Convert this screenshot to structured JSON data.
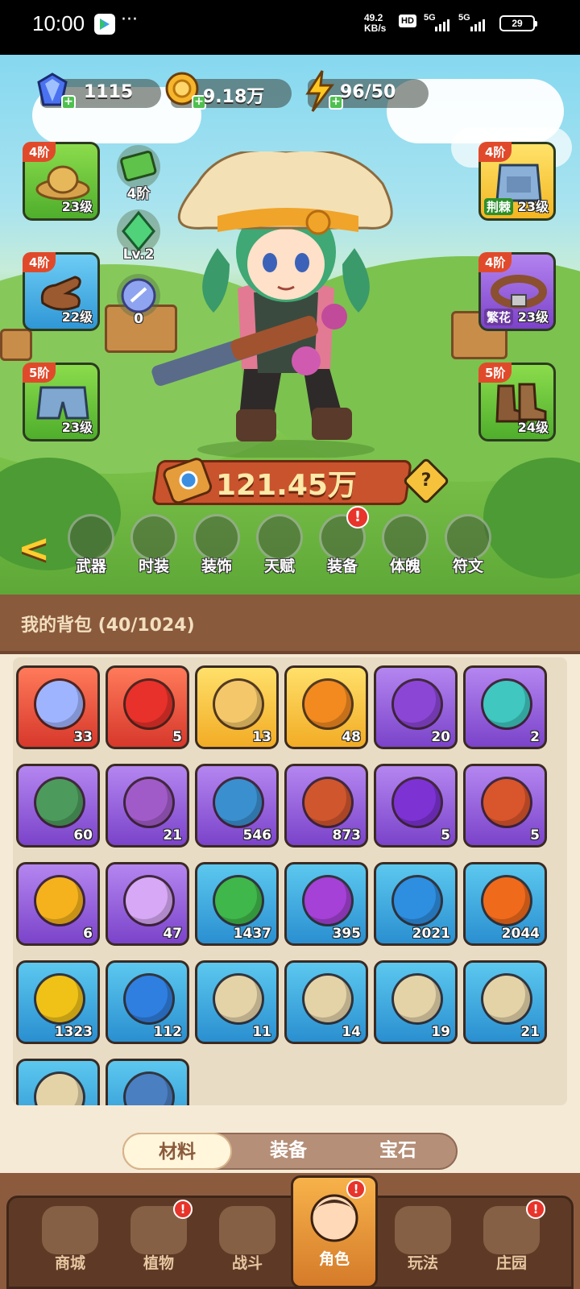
{
  "statusbar": {
    "time": "10:00",
    "more": "···",
    "speed_value": "49.2",
    "speed_unit": "KB/s",
    "hd": "HD",
    "sig1": "5G",
    "sig2": "5G",
    "battery": "29"
  },
  "resources": {
    "diamond": "1115",
    "gold": "9.18万",
    "energy": "96/50"
  },
  "equip_left": [
    {
      "tier": "4阶",
      "level": "23级",
      "icon": "straw-hat-icon"
    },
    {
      "tier": "4阶",
      "level": "22级",
      "icon": "glove-icon"
    },
    {
      "tier": "5阶",
      "level": "23级",
      "icon": "shorts-icon"
    }
  ],
  "equip_right": [
    {
      "tier": "4阶",
      "tag": "荆棘",
      "level": "23级",
      "icon": "overalls-icon"
    },
    {
      "tier": "4阶",
      "tag": "繁花",
      "level": "23级",
      "icon": "belt-icon"
    },
    {
      "tier": "5阶",
      "level": "24级",
      "icon": "boots-icon"
    }
  ],
  "mid_items": [
    {
      "label": "4阶",
      "icon": "cash-icon"
    },
    {
      "label": "Lv.2",
      "icon": "green-gem-icon"
    },
    {
      "label": "0",
      "icon": "rune-orb-icon"
    }
  ],
  "power": "121.45万",
  "help": "?",
  "nav_tabs": [
    {
      "label": "武器"
    },
    {
      "label": "时装"
    },
    {
      "label": "装饰"
    },
    {
      "label": "天赋"
    },
    {
      "label": "装备",
      "badge": "!"
    },
    {
      "label": "体魄"
    },
    {
      "label": "符文"
    }
  ],
  "bag": {
    "title": "我的背包 (40/1024)",
    "items": [
      {
        "count": "33",
        "rarity": "red",
        "icon": "star-crystal-icon",
        "color": "#9fb4ff"
      },
      {
        "count": "5",
        "rarity": "red",
        "icon": "red-potion-icon",
        "color": "#e8312a"
      },
      {
        "count": "13",
        "rarity": "gold",
        "icon": "key-icon",
        "color": "#f4c86a"
      },
      {
        "count": "48",
        "rarity": "gold",
        "icon": "orange-potion-icon",
        "color": "#f28a20"
      },
      {
        "count": "20",
        "rarity": "purple",
        "icon": "purple-bottle-icon",
        "color": "#8c46d6"
      },
      {
        "count": "2",
        "rarity": "purple",
        "icon": "leaf-icon",
        "color": "#3fc7c0"
      },
      {
        "count": "60",
        "rarity": "purple",
        "icon": "scroll-green-icon",
        "color": "#4c9a5c"
      },
      {
        "count": "21",
        "rarity": "purple",
        "icon": "scroll-purple-icon",
        "color": "#a15bc8"
      },
      {
        "count": "546",
        "rarity": "purple",
        "icon": "scroll-blue-icon",
        "color": "#3a8fcf"
      },
      {
        "count": "873",
        "rarity": "purple",
        "icon": "scroll-red-icon",
        "color": "#d0562e"
      },
      {
        "count": "5",
        "rarity": "purple",
        "icon": "purple-potion-icon",
        "color": "#7d32d4"
      },
      {
        "count": "5",
        "rarity": "purple",
        "icon": "fruit-bowl-icon",
        "color": "#d9552c"
      },
      {
        "count": "6",
        "rarity": "purple",
        "icon": "drop-icon",
        "color": "#f5b21c"
      },
      {
        "count": "47",
        "rarity": "purple",
        "icon": "crystal-icon",
        "color": "#d7a8f5"
      },
      {
        "count": "1437",
        "rarity": "blue",
        "icon": "green-seed-icon",
        "color": "#3fb74a"
      },
      {
        "count": "395",
        "rarity": "blue",
        "icon": "purple-seed-icon",
        "color": "#a541d6"
      },
      {
        "count": "2021",
        "rarity": "blue",
        "icon": "blue-seed-icon",
        "color": "#2e8ee0"
      },
      {
        "count": "2044",
        "rarity": "blue",
        "icon": "fire-seed-icon",
        "color": "#f06a1c"
      },
      {
        "count": "1323",
        "rarity": "blue",
        "icon": "yellow-seed-icon",
        "color": "#f0c218"
      },
      {
        "count": "112",
        "rarity": "blue",
        "icon": "blue-potion-icon",
        "color": "#2f7fe0"
      },
      {
        "count": "11",
        "rarity": "blue",
        "icon": "blueprint-hat-icon",
        "color": "#e5d3a8"
      },
      {
        "count": "14",
        "rarity": "blue",
        "icon": "blueprint-shirt-icon",
        "color": "#e5d3a8"
      },
      {
        "count": "19",
        "rarity": "blue",
        "icon": "blueprint-glove-icon",
        "color": "#e5d3a8"
      },
      {
        "count": "21",
        "rarity": "blue",
        "icon": "blueprint-belt-icon",
        "color": "#e5d3a8"
      },
      {
        "count": "",
        "rarity": "blue",
        "icon": "blueprint-icon",
        "color": "#e5d3a8"
      },
      {
        "count": "",
        "rarity": "blue",
        "icon": "book-icon",
        "color": "#4a7fc2"
      }
    ]
  },
  "bag_tabs": [
    {
      "label": "材料",
      "active": true
    },
    {
      "label": "装备",
      "active": false
    },
    {
      "label": "宝石",
      "active": false
    }
  ],
  "bottom_nav": [
    {
      "label": "商城",
      "badge": ""
    },
    {
      "label": "植物",
      "badge": "!"
    },
    {
      "label": "战斗",
      "badge": ""
    },
    {
      "label": "角色",
      "badge": "!",
      "active": true
    },
    {
      "label": "玩法",
      "badge": ""
    },
    {
      "label": "庄园",
      "badge": "!"
    }
  ]
}
